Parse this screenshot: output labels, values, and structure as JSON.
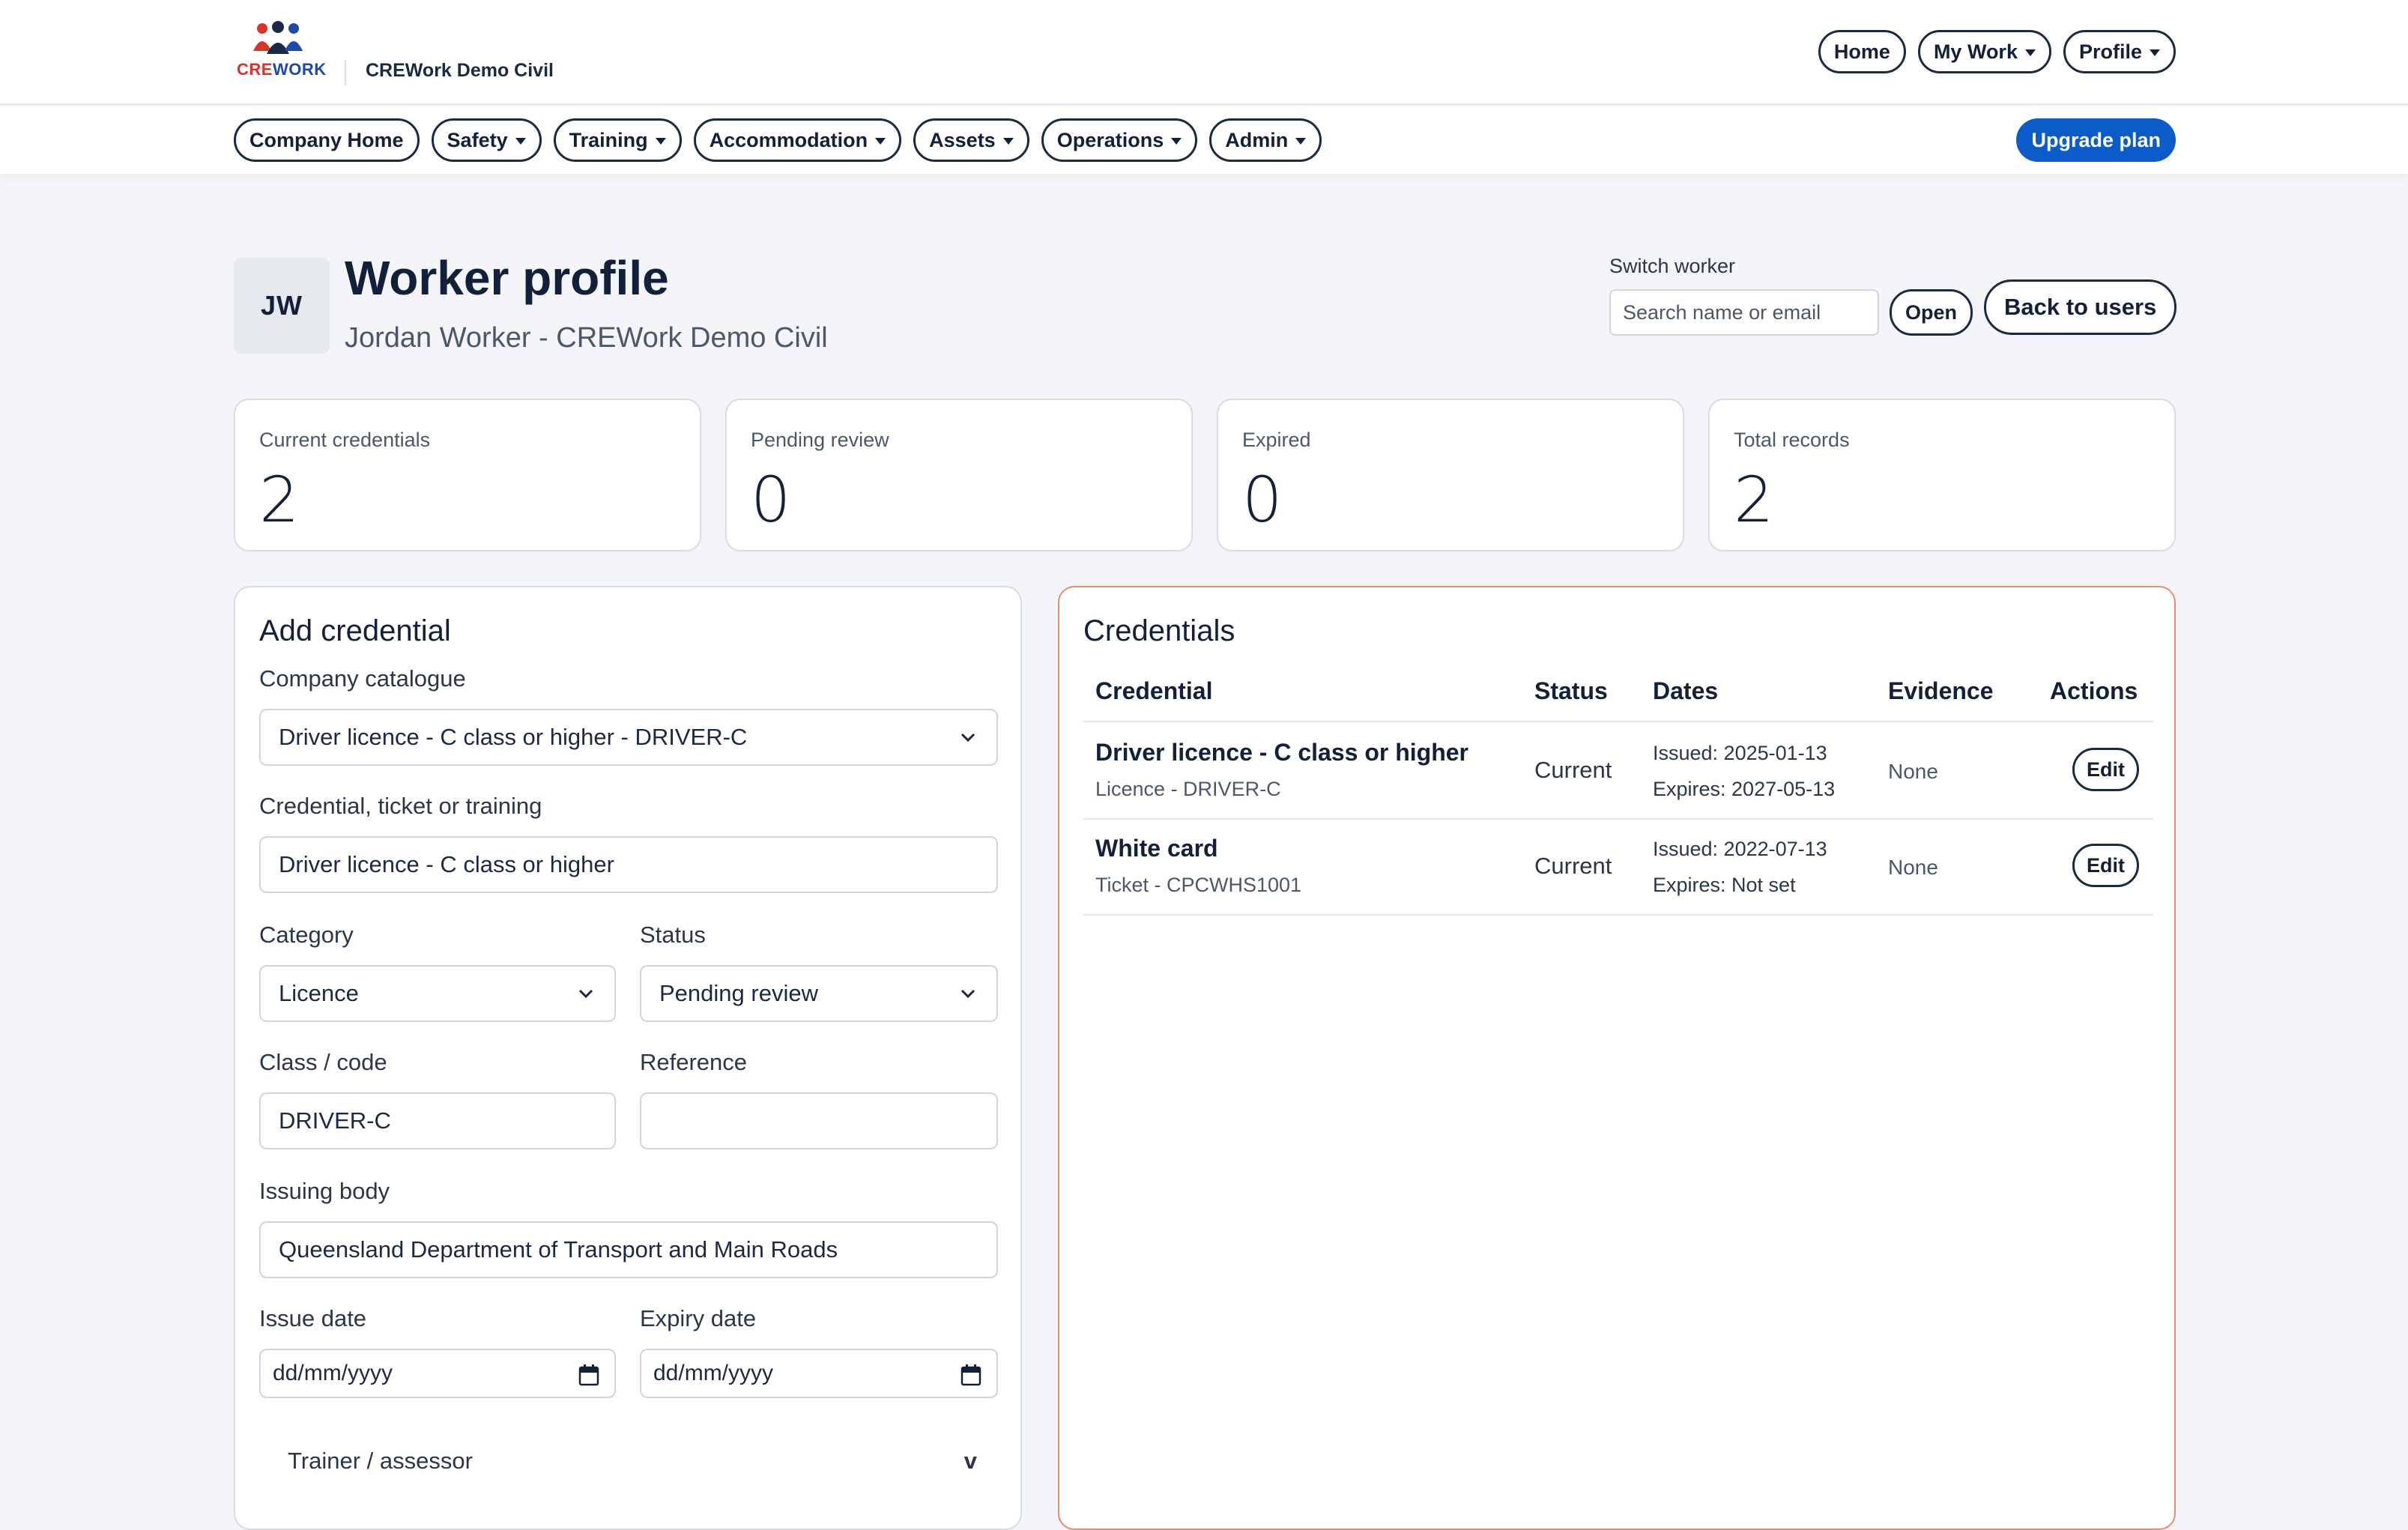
{
  "brand": {
    "crew": "CRE",
    "work": "WORK",
    "company": "CREWork Demo Civil"
  },
  "top_nav": {
    "home": "Home",
    "my_work": "My Work",
    "profile": "Profile"
  },
  "sub_nav": {
    "items": [
      "Company Home",
      "Safety",
      "Training",
      "Accommodation",
      "Assets",
      "Operations",
      "Admin"
    ],
    "upgrade": "Upgrade plan"
  },
  "header": {
    "initials": "JW",
    "title": "Worker profile",
    "subtitle": "Jordan Worker - CREWork Demo Civil",
    "switch_label": "Switch worker",
    "switch_placeholder": "Search name or email",
    "open": "Open",
    "back": "Back to users"
  },
  "stats": [
    {
      "label": "Current credentials",
      "value": "2"
    },
    {
      "label": "Pending review",
      "value": "0"
    },
    {
      "label": "Expired",
      "value": "0"
    },
    {
      "label": "Total records",
      "value": "2"
    }
  ],
  "add_credential": {
    "title": "Add credential",
    "catalogue_label": "Company catalogue",
    "catalogue_value": "Driver licence - C class or higher - DRIVER-C",
    "credential_label": "Credential, ticket or training",
    "credential_value": "Driver licence - C class or higher",
    "category_label": "Category",
    "category_value": "Licence",
    "status_label": "Status",
    "status_value": "Pending review",
    "class_label": "Class / code",
    "class_value": "DRIVER-C",
    "reference_label": "Reference",
    "reference_value": "",
    "issuing_label": "Issuing body",
    "issuing_value": "Queensland Department of Transport and Main Roads",
    "issue_label": "Issue date",
    "issue_value": "dd/mm/yyyy",
    "expiry_label": "Expiry date",
    "expiry_value": "dd/mm/yyyy",
    "trainer_label": "Trainer / assessor",
    "trainer_toggle": "v"
  },
  "credentials": {
    "title": "Credentials",
    "headers": {
      "credential": "Credential",
      "status": "Status",
      "dates": "Dates",
      "evidence": "Evidence",
      "actions": "Actions"
    },
    "rows": [
      {
        "name": "Driver licence - C class or higher",
        "meta": "Licence - DRIVER-C",
        "status": "Current",
        "issued": "Issued: 2025-01-13",
        "expires": "Expires: 2027-05-13",
        "evidence": "None",
        "action": "Edit"
      },
      {
        "name": "White card",
        "meta": "Ticket - CPCWHS1001",
        "status": "Current",
        "issued": "Issued: 2022-07-13",
        "expires": "Expires: Not set",
        "evidence": "None",
        "action": "Edit"
      }
    ]
  }
}
